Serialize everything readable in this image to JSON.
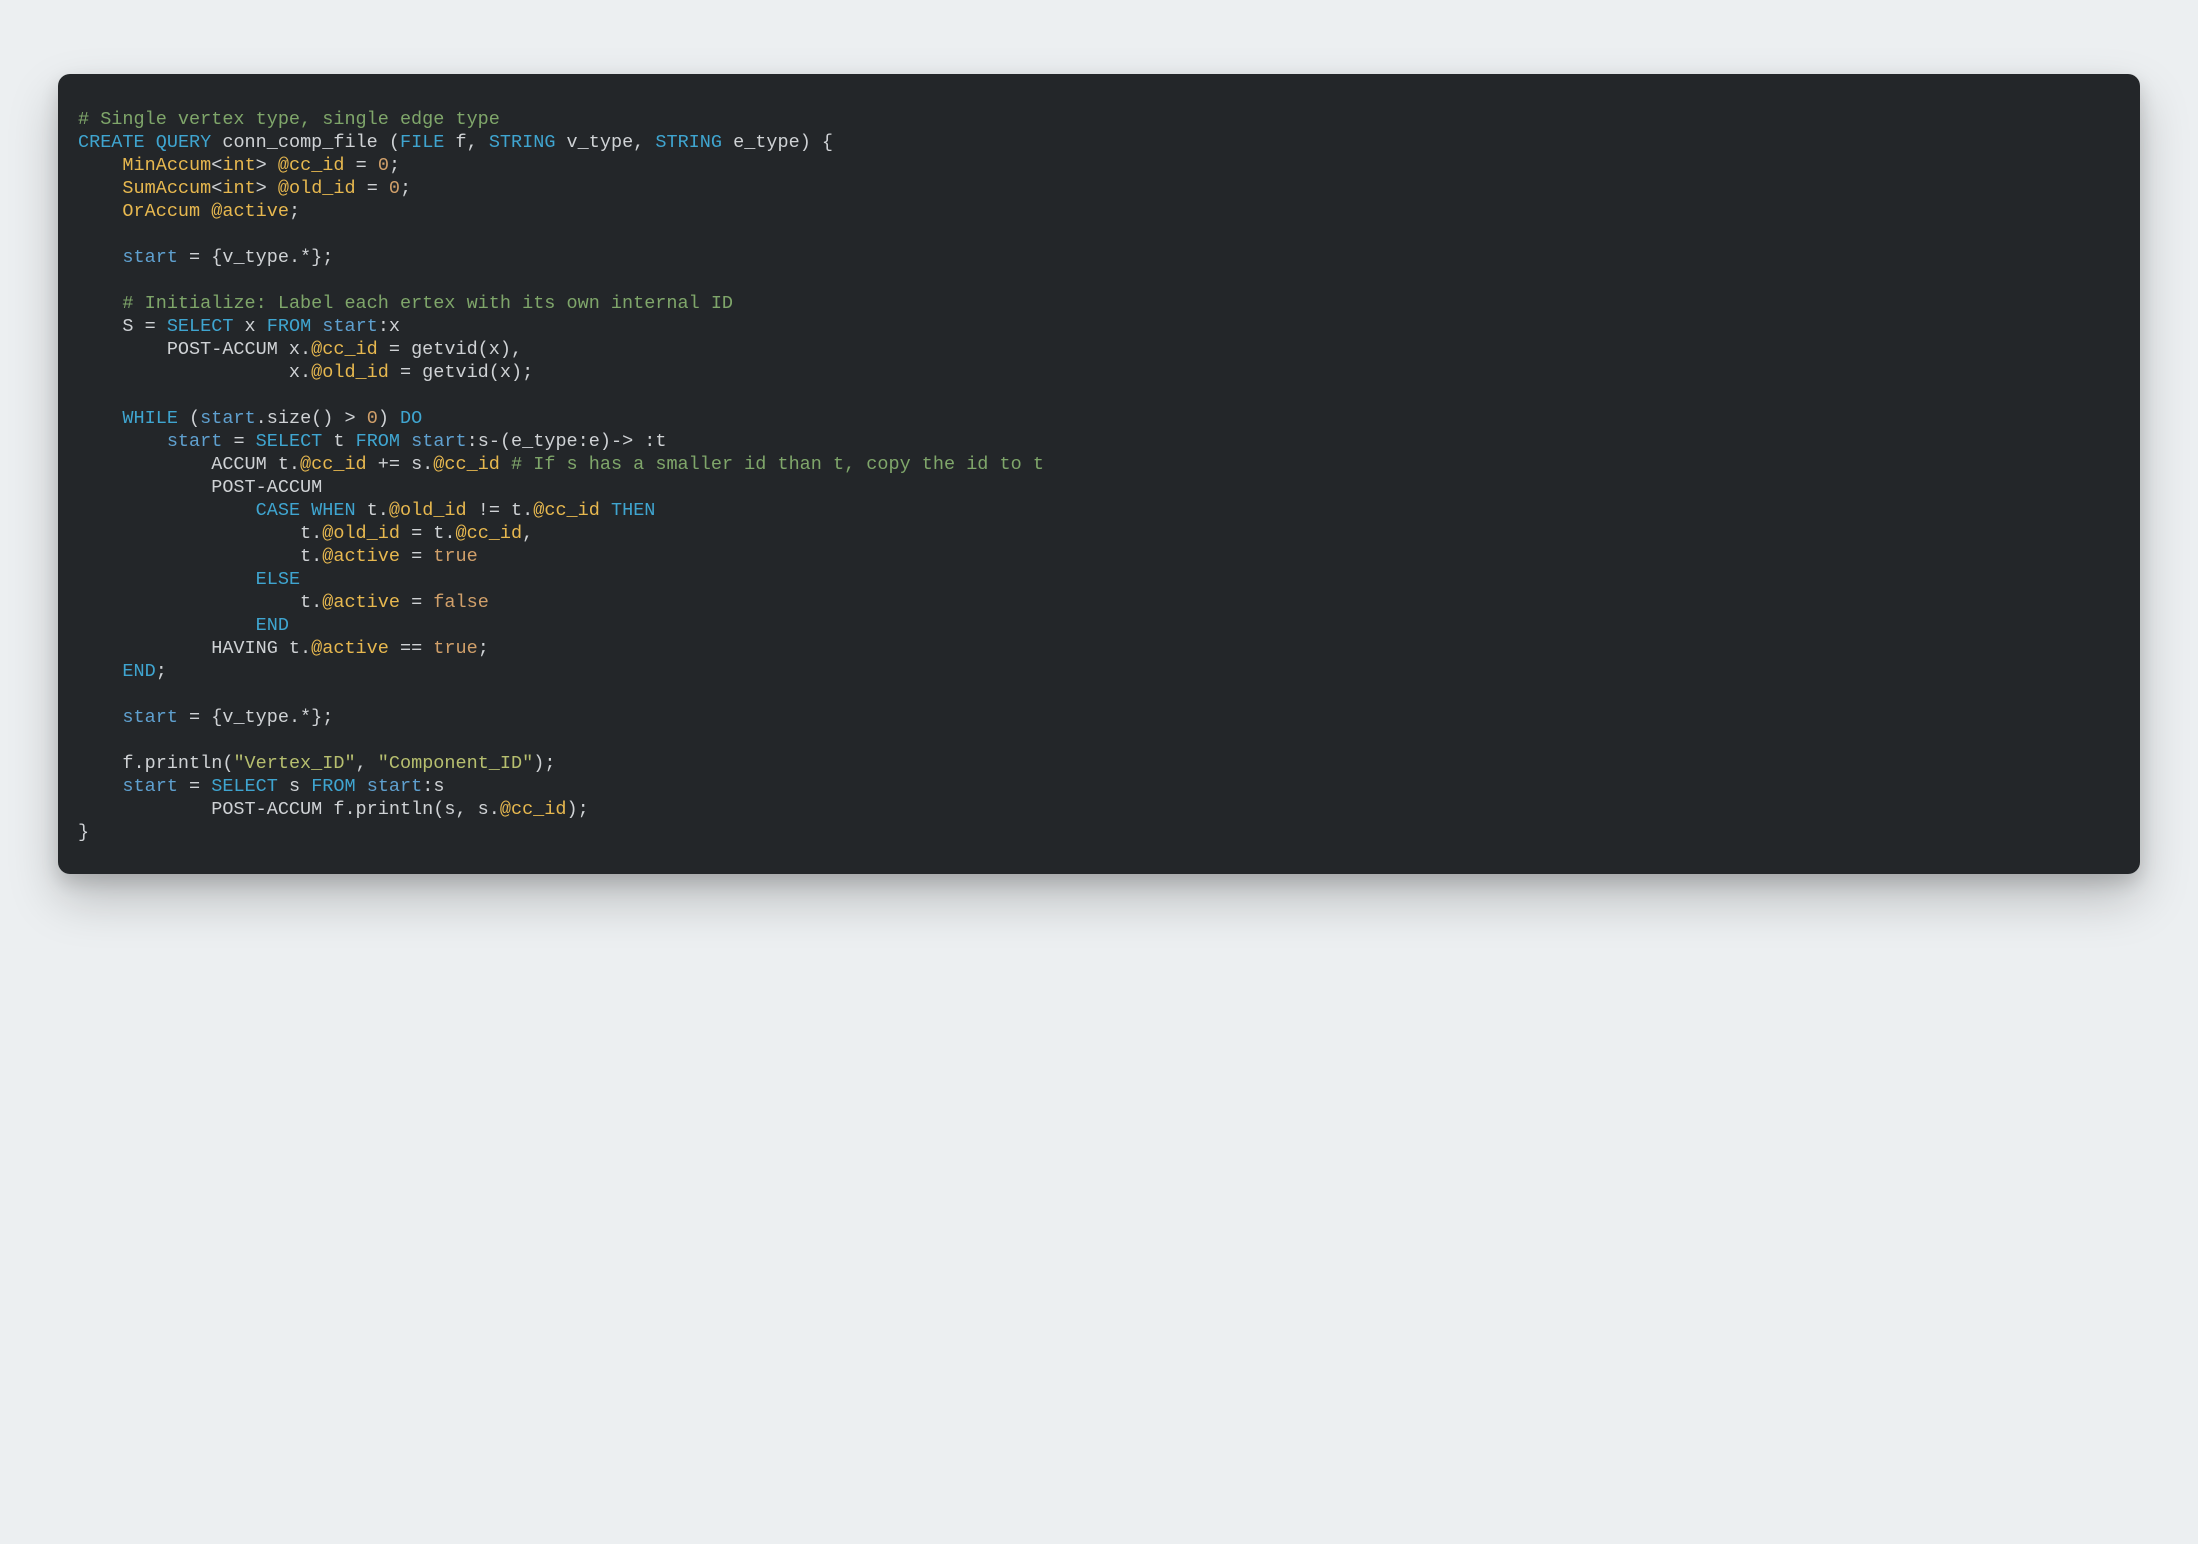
{
  "codeblock": {
    "language": "GSQL",
    "tokens": [
      [
        [
          "# Single vertex type, single edge type",
          "t-comment"
        ]
      ],
      [
        [
          "CREATE",
          "t-kw"
        ],
        [
          " ",
          "t-punc"
        ],
        [
          "QUERY",
          "t-kw"
        ],
        [
          " conn_comp_file (",
          "t-ident"
        ],
        [
          "FILE",
          "t-kw"
        ],
        [
          " f, ",
          "t-ident"
        ],
        [
          "STRING",
          "t-kw"
        ],
        [
          " v_type, ",
          "t-ident"
        ],
        [
          "STRING",
          "t-kw"
        ],
        [
          " e_type) {",
          "t-ident"
        ]
      ],
      [
        [
          "    ",
          "t-ident"
        ],
        [
          "MinAccum",
          "t-type"
        ],
        [
          "<",
          "t-punc"
        ],
        [
          "int",
          "t-type"
        ],
        [
          "> ",
          "t-punc"
        ],
        [
          "@cc_id",
          "t-decor"
        ],
        [
          " = ",
          "t-op"
        ],
        [
          "0",
          "t-num"
        ],
        [
          ";",
          "t-punc"
        ]
      ],
      [
        [
          "    ",
          "t-ident"
        ],
        [
          "SumAccum",
          "t-type"
        ],
        [
          "<",
          "t-punc"
        ],
        [
          "int",
          "t-type"
        ],
        [
          "> ",
          "t-punc"
        ],
        [
          "@old_id",
          "t-decor"
        ],
        [
          " = ",
          "t-op"
        ],
        [
          "0",
          "t-num"
        ],
        [
          ";",
          "t-punc"
        ]
      ],
      [
        [
          "    ",
          "t-ident"
        ],
        [
          "OrAccum",
          "t-type"
        ],
        [
          " ",
          "t-punc"
        ],
        [
          "@active",
          "t-decor"
        ],
        [
          ";",
          "t-punc"
        ]
      ],
      [],
      [
        [
          "    ",
          "t-ident"
        ],
        [
          "start",
          "t-var"
        ],
        [
          " = {v_type.*};",
          "t-ident"
        ]
      ],
      [],
      [
        [
          "    ",
          "t-ident"
        ],
        [
          "# Initialize: Label each ertex with its own internal ID",
          "t-comment"
        ]
      ],
      [
        [
          "    S = ",
          "t-ident"
        ],
        [
          "SELECT",
          "t-kw"
        ],
        [
          " x ",
          "t-ident"
        ],
        [
          "FROM",
          "t-kw"
        ],
        [
          " ",
          "t-ident"
        ],
        [
          "start",
          "t-var"
        ],
        [
          ":x",
          "t-ident"
        ]
      ],
      [
        [
          "        POST-ACCUM x.",
          "t-ident"
        ],
        [
          "@cc_id",
          "t-decor"
        ],
        [
          " = getvid(x),",
          "t-ident"
        ]
      ],
      [
        [
          "                   x.",
          "t-ident"
        ],
        [
          "@old_id",
          "t-decor"
        ],
        [
          " = getvid(x);",
          "t-ident"
        ]
      ],
      [],
      [
        [
          "    ",
          "t-ident"
        ],
        [
          "WHILE",
          "t-kw2"
        ],
        [
          " (",
          "t-punc"
        ],
        [
          "start",
          "t-var"
        ],
        [
          ".size() > ",
          "t-ident"
        ],
        [
          "0",
          "t-num"
        ],
        [
          ") ",
          "t-punc"
        ],
        [
          "DO",
          "t-kw2"
        ]
      ],
      [
        [
          "        ",
          "t-ident"
        ],
        [
          "start",
          "t-var"
        ],
        [
          " = ",
          "t-op"
        ],
        [
          "SELECT",
          "t-kw"
        ],
        [
          " t ",
          "t-ident"
        ],
        [
          "FROM",
          "t-kw"
        ],
        [
          " ",
          "t-ident"
        ],
        [
          "start",
          "t-var"
        ],
        [
          ":s-(e_type:e)-> :t",
          "t-ident"
        ]
      ],
      [
        [
          "            ACCUM t.",
          "t-ident"
        ],
        [
          "@cc_id",
          "t-decor"
        ],
        [
          " += s.",
          "t-ident"
        ],
        [
          "@cc_id",
          "t-decor"
        ],
        [
          " ",
          "t-ident"
        ],
        [
          "# If s has a smaller id than t, copy the id to t",
          "t-comment"
        ]
      ],
      [
        [
          "            POST-ACCUM",
          "t-ident"
        ]
      ],
      [
        [
          "                ",
          "t-ident"
        ],
        [
          "CASE",
          "t-kw2"
        ],
        [
          " ",
          "t-ident"
        ],
        [
          "WHEN",
          "t-kw2"
        ],
        [
          " t.",
          "t-ident"
        ],
        [
          "@old_id",
          "t-decor"
        ],
        [
          " != t.",
          "t-ident"
        ],
        [
          "@cc_id",
          "t-decor"
        ],
        [
          " ",
          "t-ident"
        ],
        [
          "THEN",
          "t-kw2"
        ]
      ],
      [
        [
          "                    t.",
          "t-ident"
        ],
        [
          "@old_id",
          "t-decor"
        ],
        [
          " = t.",
          "t-ident"
        ],
        [
          "@cc_id",
          "t-decor"
        ],
        [
          ",",
          "t-punc"
        ]
      ],
      [
        [
          "                    t.",
          "t-ident"
        ],
        [
          "@active",
          "t-decor"
        ],
        [
          " = ",
          "t-op"
        ],
        [
          "true",
          "t-bool"
        ]
      ],
      [
        [
          "                ",
          "t-ident"
        ],
        [
          "ELSE",
          "t-kw2"
        ]
      ],
      [
        [
          "                    t.",
          "t-ident"
        ],
        [
          "@active",
          "t-decor"
        ],
        [
          " = ",
          "t-op"
        ],
        [
          "false",
          "t-bool"
        ]
      ],
      [
        [
          "                ",
          "t-ident"
        ],
        [
          "END",
          "t-kw2"
        ]
      ],
      [
        [
          "            HAVING t.",
          "t-ident"
        ],
        [
          "@active",
          "t-decor"
        ],
        [
          " == ",
          "t-op"
        ],
        [
          "true",
          "t-bool"
        ],
        [
          ";",
          "t-punc"
        ]
      ],
      [
        [
          "    ",
          "t-ident"
        ],
        [
          "END",
          "t-kw2"
        ],
        [
          ";",
          "t-punc"
        ]
      ],
      [],
      [
        [
          "    ",
          "t-ident"
        ],
        [
          "start",
          "t-var"
        ],
        [
          " = {v_type.*};",
          "t-ident"
        ]
      ],
      [],
      [
        [
          "    f.println(",
          "t-ident"
        ],
        [
          "\"Vertex_ID\"",
          "t-str"
        ],
        [
          ", ",
          "t-punc"
        ],
        [
          "\"Component_ID\"",
          "t-str"
        ],
        [
          ");",
          "t-punc"
        ]
      ],
      [
        [
          "    ",
          "t-ident"
        ],
        [
          "start",
          "t-var"
        ],
        [
          " = ",
          "t-op"
        ],
        [
          "SELECT",
          "t-kw"
        ],
        [
          " s ",
          "t-ident"
        ],
        [
          "FROM",
          "t-kw"
        ],
        [
          " ",
          "t-ident"
        ],
        [
          "start",
          "t-var"
        ],
        [
          ":s",
          "t-ident"
        ]
      ],
      [
        [
          "            POST-ACCUM f.println(s, s.",
          "t-ident"
        ],
        [
          "@cc_id",
          "t-decor"
        ],
        [
          ");",
          "t-punc"
        ]
      ],
      [
        [
          "}",
          "t-punc"
        ]
      ]
    ]
  }
}
